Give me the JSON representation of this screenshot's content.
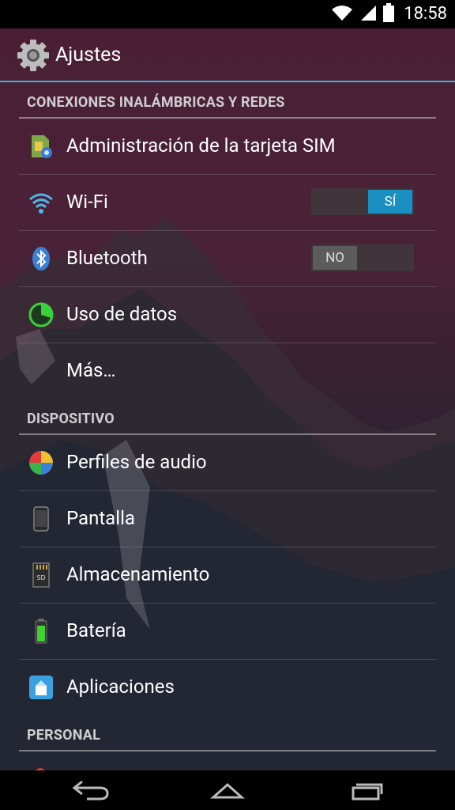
{
  "status_bar": {
    "time": "18:58",
    "icons": [
      "wifi-icon",
      "signal-icon",
      "battery-icon"
    ]
  },
  "action_bar": {
    "title": "Ajustes",
    "icon": "settings-gear-icon"
  },
  "sections": {
    "wireless": {
      "title": "CONEXIONES INALÁMBRICAS Y REDES",
      "items": [
        {
          "label": "Administración de la tarjeta SIM",
          "icon": "sim-card-icon"
        },
        {
          "label": "Wi-Fi",
          "icon": "wifi-icon",
          "toggle": "SÍ",
          "toggle_state": "on"
        },
        {
          "label": "Bluetooth",
          "icon": "bluetooth-icon",
          "toggle": "NO",
          "toggle_state": "off"
        },
        {
          "label": "Uso de datos",
          "icon": "data-usage-icon"
        },
        {
          "label": "Más…"
        }
      ]
    },
    "device": {
      "title": "DISPOSITIVO",
      "items": [
        {
          "label": "Perfiles de audio",
          "icon": "audio-profiles-icon"
        },
        {
          "label": "Pantalla",
          "icon": "display-icon"
        },
        {
          "label": "Almacenamiento",
          "icon": "sd-card-icon"
        },
        {
          "label": "Batería",
          "icon": "battery-icon"
        },
        {
          "label": "Aplicaciones",
          "icon": "apps-icon"
        }
      ]
    },
    "personal": {
      "title": "PERSONAL"
    }
  },
  "nav_bar": {
    "buttons": [
      "back-icon",
      "home-icon",
      "recents-icon"
    ]
  },
  "colors": {
    "accent": "#33b5e5",
    "toggle_on": "#1a8fc2",
    "toggle_off": "#5c5c5c"
  }
}
